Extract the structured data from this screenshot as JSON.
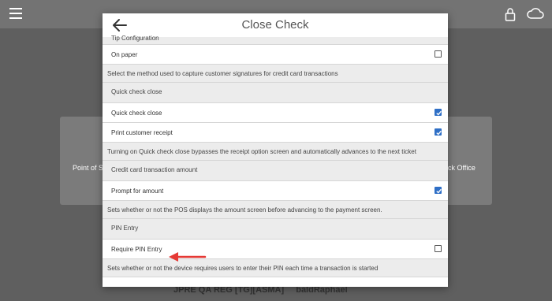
{
  "modal": {
    "title": "Close Check",
    "rows": [
      {
        "kind": "clip",
        "label": "Tip Configuration"
      },
      {
        "kind": "opt",
        "label": "On paper",
        "checked": false
      },
      {
        "kind": "desc",
        "label": "Select the method used to capture customer signatures for credit card transactions"
      },
      {
        "kind": "head",
        "label": "Quick check close"
      },
      {
        "kind": "opt",
        "label": "Quick check close",
        "checked": true
      },
      {
        "kind": "opt",
        "label": "Print customer receipt",
        "checked": true
      },
      {
        "kind": "desc",
        "label": "Turning on Quick check close bypasses the receipt option screen and automatically advances to the next ticket"
      },
      {
        "kind": "head",
        "label": "Credit card transaction amount"
      },
      {
        "kind": "opt",
        "label": "Prompt for amount",
        "checked": true
      },
      {
        "kind": "desc",
        "label": "Sets whether or not the POS displays the amount screen before advancing to the payment screen."
      },
      {
        "kind": "head",
        "label": "PIN Entry"
      },
      {
        "kind": "opt",
        "label": "Require PIN Entry",
        "checked": false
      },
      {
        "kind": "desc",
        "label": "Sets whether or not the device requires users to enter their PIN each time a transaction is started"
      }
    ]
  },
  "background": {
    "card_left_label": "Point of S",
    "card_right_label": "ck Office",
    "bottom_text": "JPRE QA REG [TG][ASMA]",
    "bottom_user": "baldRaphael"
  },
  "colors": {
    "accent": "#2f6fc6",
    "annotation": "#e53935"
  },
  "icons": [
    "menu-icon",
    "lock-icon",
    "cloud-icon",
    "back-arrow-icon",
    "check-icon",
    "annotation-arrow"
  ]
}
